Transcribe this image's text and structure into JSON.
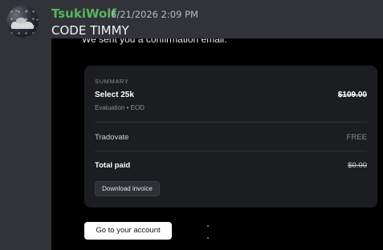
{
  "message": {
    "author": "TsukiWolf",
    "timestamp": "6/21/2026 2:09 PM",
    "text": "CODE TIMMY",
    "author_color": "#57b65d"
  },
  "screenshot": {
    "cut_off_line": "We sent you a confirmation email.",
    "summary": {
      "heading": "SUMMARY",
      "plan_name": "Select 25k",
      "plan_price": "$109.00",
      "plan_detail": "Evaluation • EOD",
      "platform_label": "Tradovate",
      "platform_value": "FREE",
      "total_label": "Total paid",
      "total_value": "$0.00",
      "invoice_button": "Download invoice"
    },
    "account_button": "Go to your account"
  }
}
